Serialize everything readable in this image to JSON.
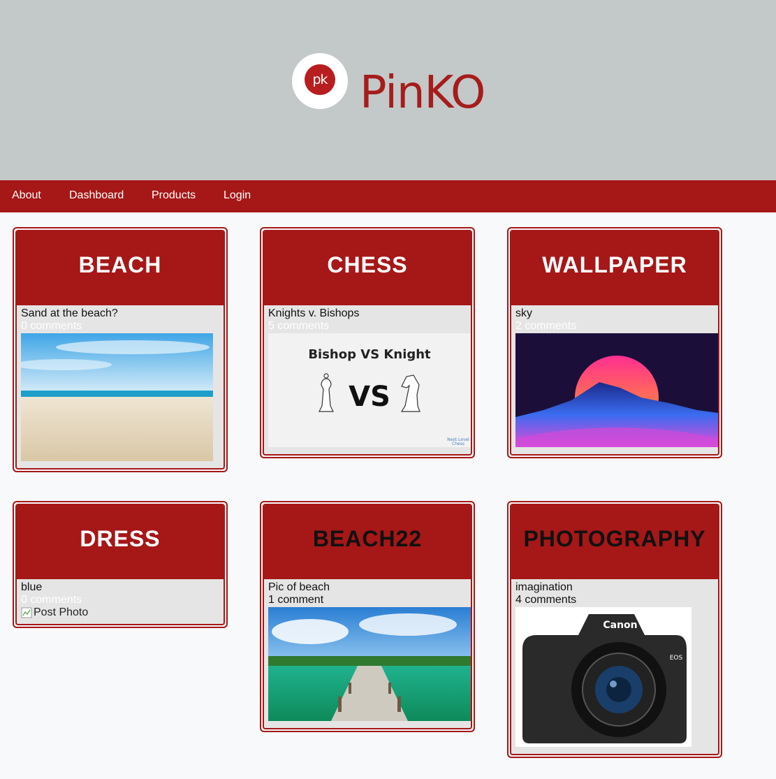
{
  "brand": {
    "logo_initials": "pk",
    "name": "PinKO"
  },
  "nav": {
    "items": [
      "About",
      "Dashboard",
      "Products",
      "Login"
    ]
  },
  "cards": [
    {
      "title": "BEACH",
      "title_color": "#ffffff",
      "description": "Sand at the beach?",
      "comments": "0 comments",
      "comments_color": "#ffffff",
      "image": "beach-sand-photo"
    },
    {
      "title": "CHESS",
      "title_color": "#ffffff",
      "description": "Knights v. Bishops",
      "comments": "5 comments",
      "comments_color": "#ffffff",
      "image": "chess-photo",
      "image_text": {
        "headline": "Bishop VS Knight",
        "vs": "VS",
        "credit_line1": "Next Level",
        "credit_line2": "Chess"
      }
    },
    {
      "title": "WALLPAPER",
      "title_color": "#ffffff",
      "description": "sky",
      "comments": "2 comments",
      "comments_color": "#ffffff",
      "image": "synthwave-wallpaper-photo"
    },
    {
      "title": "DRESS",
      "title_color": "#ffffff",
      "description": "blue",
      "comments": "0 comments",
      "comments_color": "#ffffff",
      "image_alt": "Post Photo"
    },
    {
      "title": "BEACH22",
      "title_color": "#111111",
      "description": "Pic of beach",
      "comments": "1 comment",
      "comments_color": "#111111",
      "image": "tropical-pier-photo"
    },
    {
      "title": "PHOTOGRAPHY",
      "title_color": "#111111",
      "description": "imagination",
      "comments": "4 comments",
      "comments_color": "#111111",
      "image": "canon-camera-photo",
      "image_text": {
        "brand": "Canon",
        "model": "EOS"
      }
    }
  ],
  "colors": {
    "brand_red": "#a61717",
    "header_gray": "#c3c8c8",
    "card_body": "#e5e5e5"
  }
}
